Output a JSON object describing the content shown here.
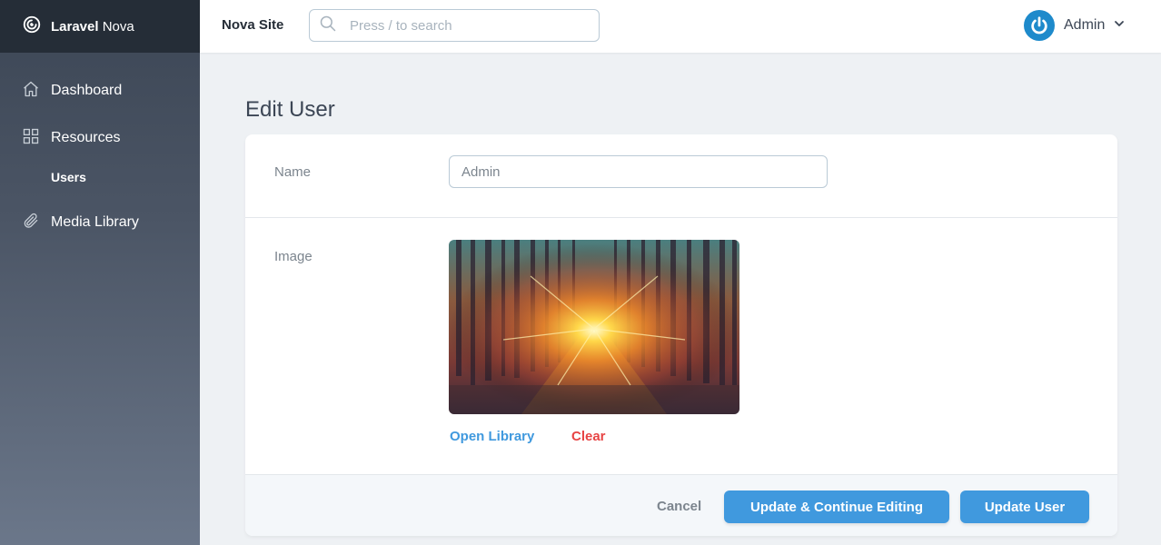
{
  "sidebar": {
    "brand": {
      "bold": "Laravel",
      "rest": " Nova",
      "icon": "laravel-logo-icon"
    },
    "items": [
      {
        "label": "Dashboard",
        "icon": "home-icon"
      },
      {
        "label": "Resources",
        "icon": "grid-icon"
      },
      {
        "label": "Users"
      },
      {
        "label": "Media Library",
        "icon": "paperclip-icon"
      }
    ]
  },
  "header": {
    "site_name": "Nova Site",
    "search_placeholder": "Press / to search",
    "user_name": "Admin"
  },
  "main": {
    "title": "Edit User",
    "fields": {
      "name_label": "Name",
      "name_value": "Admin",
      "image_label": "Image"
    },
    "image_actions": {
      "open_library": "Open Library",
      "clear": "Clear"
    },
    "footer": {
      "cancel": "Cancel",
      "update_continue": "Update & Continue Editing",
      "update": "Update User"
    }
  },
  "colors": {
    "accent": "#4099de",
    "danger": "#e74444",
    "sidebar_dark": "#252d37"
  }
}
